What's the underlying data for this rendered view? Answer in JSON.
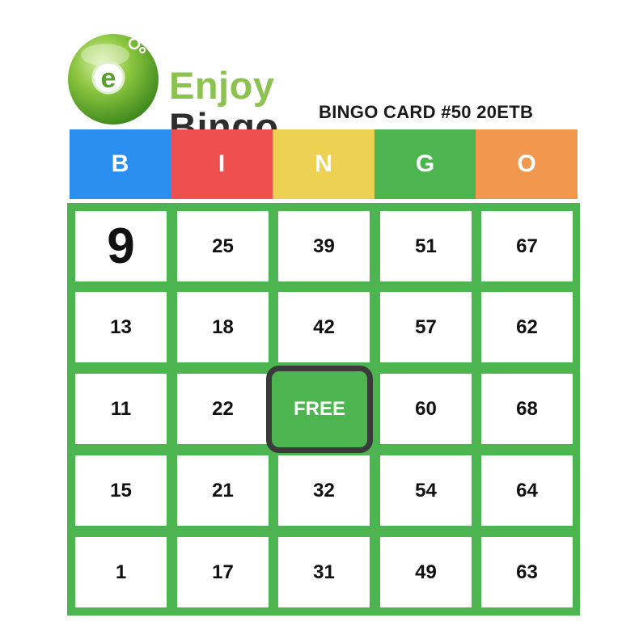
{
  "logo": {
    "badge_letter": "e",
    "word1": "Enjoy",
    "word2": "Bingo"
  },
  "card_title": "BINGO CARD #50 20ETB",
  "header": [
    {
      "letter": "B",
      "color": "#2b8ff0"
    },
    {
      "letter": "I",
      "color": "#ee5050"
    },
    {
      "letter": "N",
      "color": "#ecd152"
    },
    {
      "letter": "G",
      "color": "#4cb54f"
    },
    {
      "letter": "O",
      "color": "#f2974e"
    }
  ],
  "grid_color": "#4cb54f",
  "rows": [
    [
      "9",
      "25",
      "39",
      "51",
      "67"
    ],
    [
      "13",
      "18",
      "42",
      "57",
      "62"
    ],
    [
      "11",
      "22",
      "FREE",
      "60",
      "68"
    ],
    [
      "15",
      "21",
      "32",
      "54",
      "64"
    ],
    [
      "1",
      "17",
      "31",
      "49",
      "63"
    ]
  ],
  "highlighted_number": "9"
}
